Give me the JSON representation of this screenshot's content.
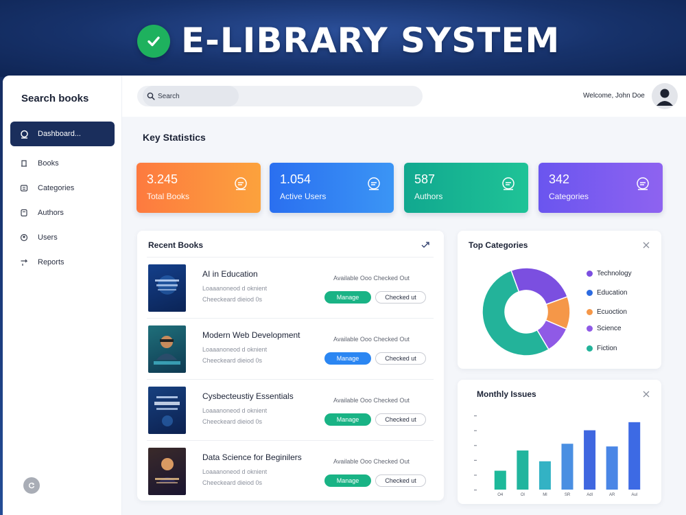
{
  "banner": {
    "title": "E-LIBRARY SYSTEM"
  },
  "sidebar": {
    "title": "Search books",
    "items": [
      {
        "label": "Dashboard...",
        "icon": "dashboard-icon",
        "active": true
      },
      {
        "label": "Books",
        "icon": "book-icon",
        "active": false
      },
      {
        "label": "Categories",
        "icon": "categories-icon",
        "active": false
      },
      {
        "label": "Authors",
        "icon": "authors-icon",
        "active": false
      },
      {
        "label": "Users",
        "icon": "users-icon",
        "active": false
      },
      {
        "label": "Reports",
        "icon": "reports-icon",
        "active": false
      }
    ]
  },
  "topbar": {
    "search_placeholder": "Search",
    "welcome": "Welcome, John Doe"
  },
  "stats": {
    "title": "Key Statistics",
    "cards": [
      {
        "value": "3.245",
        "label": "Total Books",
        "color": "#fb8a3c"
      },
      {
        "value": "1.054",
        "label": "Active Users",
        "color": "#2f7cf0"
      },
      {
        "value": "587",
        "label": "Authors",
        "color": "#16b491"
      },
      {
        "value": "342",
        "label": "Categories",
        "color": "#7b5cf0"
      }
    ]
  },
  "recent_books": {
    "title": "Recent Books",
    "manage_label": "Manage",
    "checked_label": "Checked ut",
    "rows": [
      {
        "title": "AI in Education",
        "meta1": "Loaaanoneod d oknient",
        "meta2": "Cheeckeard dieiod 0s",
        "availability": "Available  Ooo  Checked Out",
        "manage_color": "#19b385"
      },
      {
        "title": "Modern Web Development",
        "meta1": "Loaaanoneod d oknient",
        "meta2": "Cheeckeard dieiod 0s",
        "availability": "Available  Ooo  Checked Out",
        "manage_color": "#2b86f2"
      },
      {
        "title": "Cysbecteustiy Essentials",
        "meta1": "Loaaanoneod d oknient",
        "meta2": "Cheeckeard dieiod 0s",
        "availability": "Available  Ooo  Checked Out",
        "manage_color": "#19b385"
      },
      {
        "title": "Data Science for Beginilers",
        "meta1": "Loaaanoneod d oknient",
        "meta2": "Cheeckeard dieiod 0s",
        "availability": "Available  Ooo  Checked Out",
        "manage_color": "#19b385"
      }
    ]
  },
  "top_categories": {
    "title": "Top Categories",
    "legend": [
      {
        "label": "Technology",
        "color": "#7b4fe0"
      },
      {
        "label": "Education",
        "color": "#2d6be0"
      },
      {
        "label": "Ecuoction",
        "color": "#f59748"
      },
      {
        "label": "Science",
        "color": "#8f5ae6"
      },
      {
        "label": "Fiction",
        "color": "#23b39a"
      }
    ]
  },
  "monthly_issues": {
    "title": "Monthly Issues"
  },
  "chart_data": [
    {
      "type": "pie",
      "title": "Top Categories",
      "donut": true,
      "series": [
        {
          "name": "Technology",
          "value": 25,
          "color": "#7b4fe0"
        },
        {
          "name": "Education",
          "value": 12,
          "color": "#f59748"
        },
        {
          "name": "Science",
          "value": 10,
          "color": "#8f5ae6"
        },
        {
          "name": "Fiction",
          "value": 53,
          "color": "#23b39a"
        }
      ]
    },
    {
      "type": "bar",
      "title": "Monthly Issues",
      "categories": [
        "O4",
        "Ol",
        "Ml",
        "SR",
        "Adl",
        "AR",
        "Aul"
      ],
      "values": [
        28,
        58,
        42,
        68,
        88,
        64,
        100
      ],
      "colors": [
        "#1db99a",
        "#21b59e",
        "#33b2c4",
        "#4a8fe2",
        "#3f67e0",
        "#4a86e6",
        "#3d6ae4"
      ],
      "ylim": [
        0,
        110
      ],
      "grid": false
    }
  ]
}
